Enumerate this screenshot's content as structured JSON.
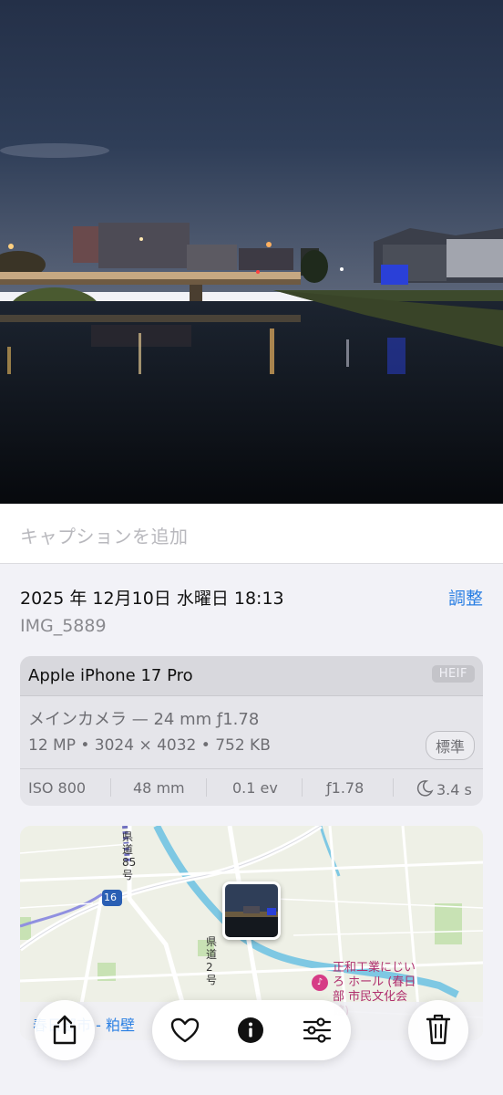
{
  "caption": {
    "placeholder": "キャプションを追加"
  },
  "info": {
    "datetime": "2025 年 12月10日 水曜日 18:13",
    "adjust_label": "調整",
    "filename": "IMG_5889"
  },
  "camera": {
    "device": "Apple iPhone 17 Pro",
    "format_badge": "HEIF",
    "lens": "メインカメラ — 24 mm ƒ1.78",
    "specs": "12 MP • 3024 × 4032 • 752 KB",
    "style_badge": "標準",
    "exif": {
      "iso": "ISO 800",
      "focal": "48 mm",
      "ev": "0.1 ev",
      "aperture": "ƒ1.78",
      "shutter": "3.4 s"
    }
  },
  "map": {
    "poi_label": "正和工業にじいろ ホール (春日部 市民文化会館)",
    "road_label": "県道85号",
    "road2_label": "県道2号",
    "route_badge": "16",
    "footer_text": "春日部市 - 粕壁"
  },
  "toolbar": {
    "share": "share-icon",
    "favorite": "heart-icon",
    "info": "info-icon",
    "edit": "sliders-icon",
    "delete": "trash-icon"
  },
  "colors": {
    "accent": "#2a7fe3",
    "poi": "#d63c86"
  }
}
